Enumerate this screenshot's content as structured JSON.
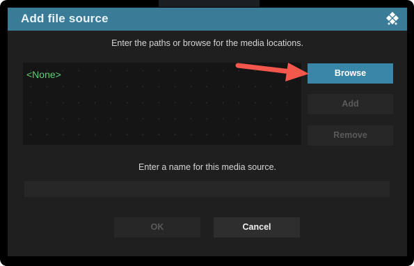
{
  "dialog": {
    "title": "Add file source",
    "logo_icon": "kodi-logo-icon",
    "paths_instruction": "Enter the paths or browse for the media locations.",
    "paths": [
      "<None>"
    ],
    "buttons": {
      "browse": "Browse",
      "add": "Add",
      "remove": "Remove"
    },
    "name_instruction": "Enter a name for this media source.",
    "name_value": "",
    "ok_label": "OK",
    "cancel_label": "Cancel"
  },
  "annotation": {
    "arrow_icon": "red-arrow-icon",
    "arrow_color": "#f4574c"
  },
  "colors": {
    "titlebar": "#3a7c97",
    "accent_button": "#3a86a8",
    "path_text": "#5fcf78",
    "dialog_bg": "#1f1f1f"
  }
}
